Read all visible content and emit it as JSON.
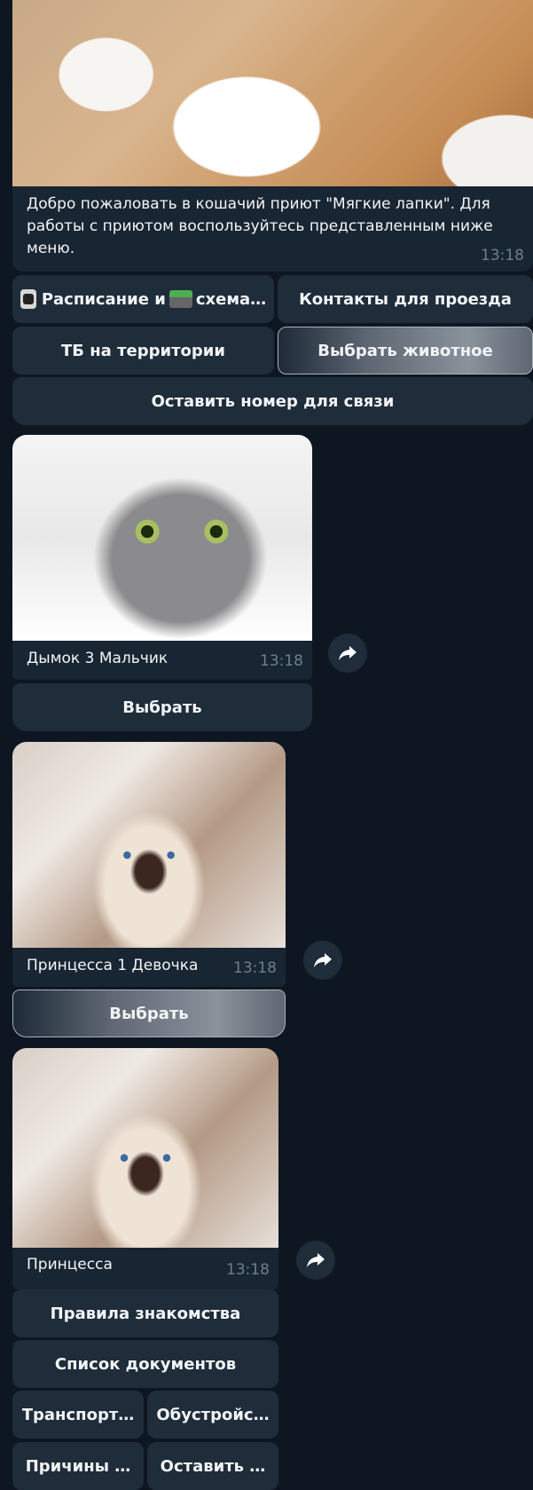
{
  "welcome": {
    "text": "Добро пожаловать в кошачий приют \"Мягкие лапки\". Для работы с приютом воспользуйтесь представленным ниже меню.",
    "time": "13:18",
    "image": "cat-paws-photo"
  },
  "main_menu": {
    "schedule_label": "Расписание и",
    "schedule_label_2": "схема…",
    "schedule_icons": [
      "watch-icon",
      "motorway-icon"
    ],
    "contacts_label": "Контакты для проезда",
    "safety_label": "ТБ на территории",
    "choose_animal_label": "Выбрать животное",
    "leave_number_label": "Оставить номер для связи"
  },
  "animals": [
    {
      "caption": "Дымок 3 Мальчик",
      "time": "13:18",
      "button": "Выбрать",
      "image": "gray-cat-photo"
    },
    {
      "caption": "Принцесса 1 Девочка",
      "time": "13:18",
      "button": "Выбрать",
      "image": "siamese-kitten-photo"
    }
  ],
  "selected": {
    "caption": "Принцесса",
    "time": "13:18",
    "image": "siamese-kitten-photo",
    "buttons": {
      "rules": "Правила знакомства",
      "documents": "Список документов",
      "transport": "Транспорт…",
      "arrangement": "Обустройс…",
      "reasons": "Причины …",
      "leave": "Оставить …"
    }
  },
  "colors": {
    "background": "#0e1621",
    "bubble": "#182533",
    "button": "#1f2c3a",
    "time": "#6d7f8f"
  }
}
